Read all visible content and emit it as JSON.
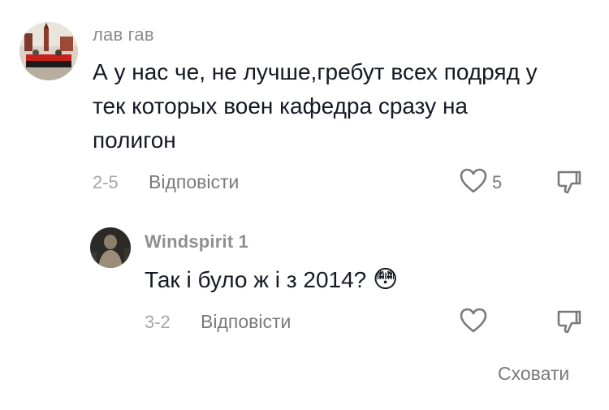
{
  "comments": [
    {
      "author": "лав гав",
      "text_lines": [
        "А у нас че, не лучше,гребут всех подряд у",
        "тек которых воен кафедра сразу на",
        "полигон"
      ],
      "date": "2-5",
      "reply_label": "Відповісти",
      "likes": "5",
      "icons": {
        "avatar": "avatar",
        "like": "heart-icon",
        "dislike": "thumbs-down-icon"
      }
    },
    {
      "author": "Windspirit 1",
      "text": "Так і було ж і з 2014?",
      "emoji": "😳",
      "date": "3-2",
      "reply_label": "Відповісти",
      "icons": {
        "avatar": "avatar",
        "like": "heart-icon",
        "dislike": "thumbs-down-icon"
      }
    }
  ],
  "hide_replies_label": "Сховати",
  "colors": {
    "text": "#161823",
    "author": "#8a8a8a",
    "meta": "#a6a6a6",
    "action": "#7a7a7a"
  }
}
